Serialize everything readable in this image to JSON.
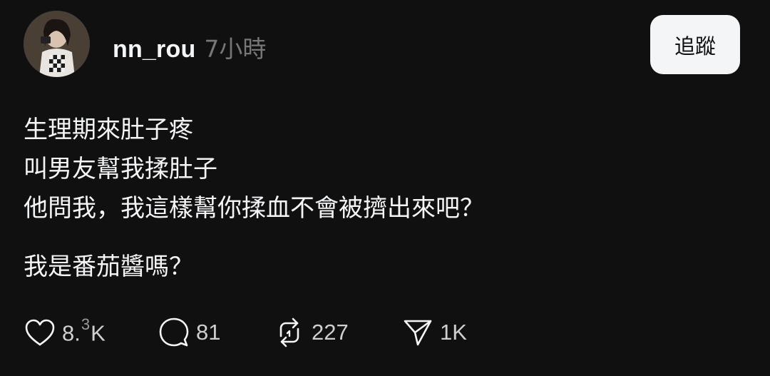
{
  "post": {
    "username": "nn_rou",
    "timestamp": "7小時",
    "follow_label": "追蹤",
    "body_lines": [
      "生理期來肚子疼",
      "叫男友幫我揉肚子",
      "他問我，我這樣幫你揉血不會被擠出來吧？"
    ],
    "body_paragraph2": "我是番茄醬嗎？"
  },
  "actions": {
    "like": {
      "icon": "heart-icon",
      "count_a": "8.",
      "count_sup": "3",
      "count_b": "K"
    },
    "reply": {
      "icon": "comment-icon",
      "count": "81"
    },
    "repost": {
      "icon": "repost-icon",
      "count": "227"
    },
    "share": {
      "icon": "send-icon",
      "count": "1K"
    }
  },
  "colors": {
    "background": "#101010",
    "text": "#f3f5f7",
    "muted": "#777777",
    "button_bg": "#f3f5f7"
  }
}
